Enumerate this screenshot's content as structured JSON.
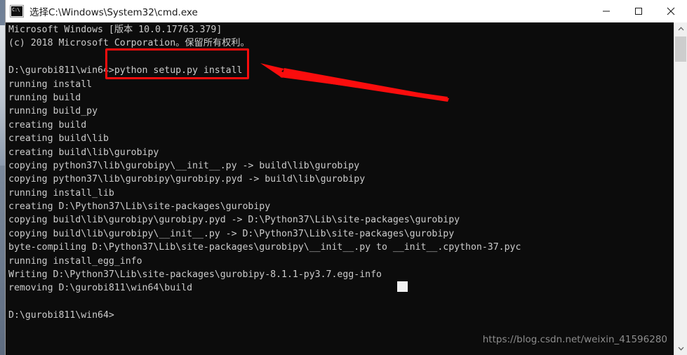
{
  "window": {
    "title": "选择C:\\Windows\\System32\\cmd.exe",
    "icon_name": "cmd-console-icon",
    "controls": {
      "minimize_label": "最小化",
      "maximize_label": "最大化",
      "close_label": "关闭"
    }
  },
  "console": {
    "background_color": "#0c0c0c",
    "text_color": "#cccccc",
    "lines": [
      "Microsoft Windows [版本 10.0.17763.379]",
      "(c) 2018 Microsoft Corporation。保留所有权利。",
      "",
      "D:\\gurobi811\\win64>python setup.py install",
      "running install",
      "running build",
      "running build_py",
      "creating build",
      "creating build\\lib",
      "creating build\\lib\\gurobipy",
      "copying python37\\lib\\gurobipy\\__init__.py -> build\\lib\\gurobipy",
      "copying python37\\lib\\gurobipy\\gurobipy.pyd -> build\\lib\\gurobipy",
      "running install_lib",
      "creating D:\\Python37\\Lib\\site-packages\\gurobipy",
      "copying build\\lib\\gurobipy\\gurobipy.pyd -> D:\\Python37\\Lib\\site-packages\\gurobipy",
      "copying build\\lib\\gurobipy\\__init__.py -> D:\\Python37\\Lib\\site-packages\\gurobipy",
      "byte-compiling D:\\Python37\\Lib\\site-packages\\gurobipy\\__init__.py to __init__.cpython-37.pyc",
      "running install_egg_info",
      "Writing D:\\Python37\\Lib\\site-packages\\gurobipy-8.1.1-py3.7.egg-info",
      "removing D:\\gurobi811\\win64\\build",
      "",
      "D:\\gurobi811\\win64>"
    ],
    "prompt": "D:\\gurobi811\\win64>",
    "command": "python setup.py install",
    "cursor_visible": true
  },
  "annotation": {
    "highlight_color": "#fb0d0d",
    "highlighted_text": "python setup.py install",
    "arrow_color": "#fb0d0d",
    "arrow_direction": "points-left-to-highlight"
  },
  "watermark": {
    "text": "https://blog.csdn.net/weixin_41596280",
    "color": "#8d8d8d"
  },
  "scrollbar": {
    "up_arrow": "▲",
    "down_arrow": "▼",
    "thumb_position": "near-top"
  }
}
